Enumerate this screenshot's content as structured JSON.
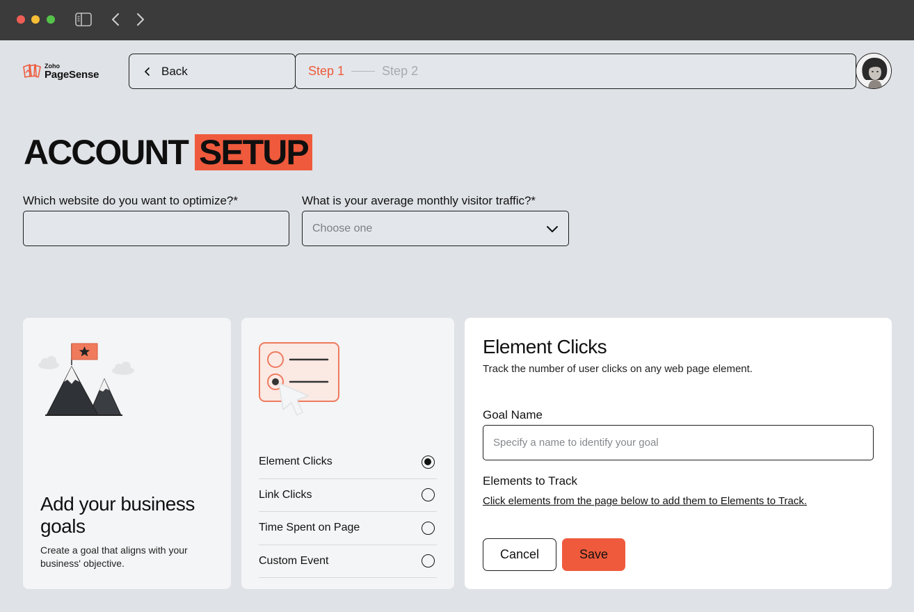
{
  "titlebar": {
    "icons": [
      "sidebar-toggle-icon",
      "chevron-left-icon",
      "chevron-right-icon"
    ]
  },
  "header": {
    "logo_small": "Zoho",
    "logo_name": "PageSense",
    "back_label": "Back",
    "steps": [
      {
        "label": "Step 1",
        "active": true
      },
      {
        "label": "Step 2",
        "active": false
      }
    ]
  },
  "page": {
    "title_plain": "ACCOUNT",
    "title_highlight": "SETUP"
  },
  "form": {
    "website_label": "Which website do you want to optimize?*",
    "website_value": "",
    "traffic_label": "What is your average monthly visitor traffic?*",
    "traffic_value": "Choose one"
  },
  "goals_card": {
    "heading": "Add your business goals",
    "subtext": "Create a goal that aligns with your business' objective."
  },
  "goal_types": {
    "items": [
      {
        "label": "Element Clicks",
        "selected": true
      },
      {
        "label": "Link Clicks",
        "selected": false
      },
      {
        "label": "Time Spent on Page",
        "selected": false
      },
      {
        "label": "Custom Event",
        "selected": false
      }
    ]
  },
  "element_clicks": {
    "title": "Element Clicks",
    "description": "Track the number of user clicks on any web page element.",
    "goal_name_label": "Goal Name",
    "goal_name_placeholder": "Specify a name to identify your goal",
    "goal_name_value": "",
    "elements_label": "Elements to Track",
    "elements_link": "Click elements from the page below to add them to Elements to Track.",
    "cancel_label": "Cancel",
    "save_label": "Save"
  },
  "colors": {
    "accent": "#ef5a3c",
    "background": "#dfe2e6",
    "titlebar": "#3b3b3b"
  }
}
